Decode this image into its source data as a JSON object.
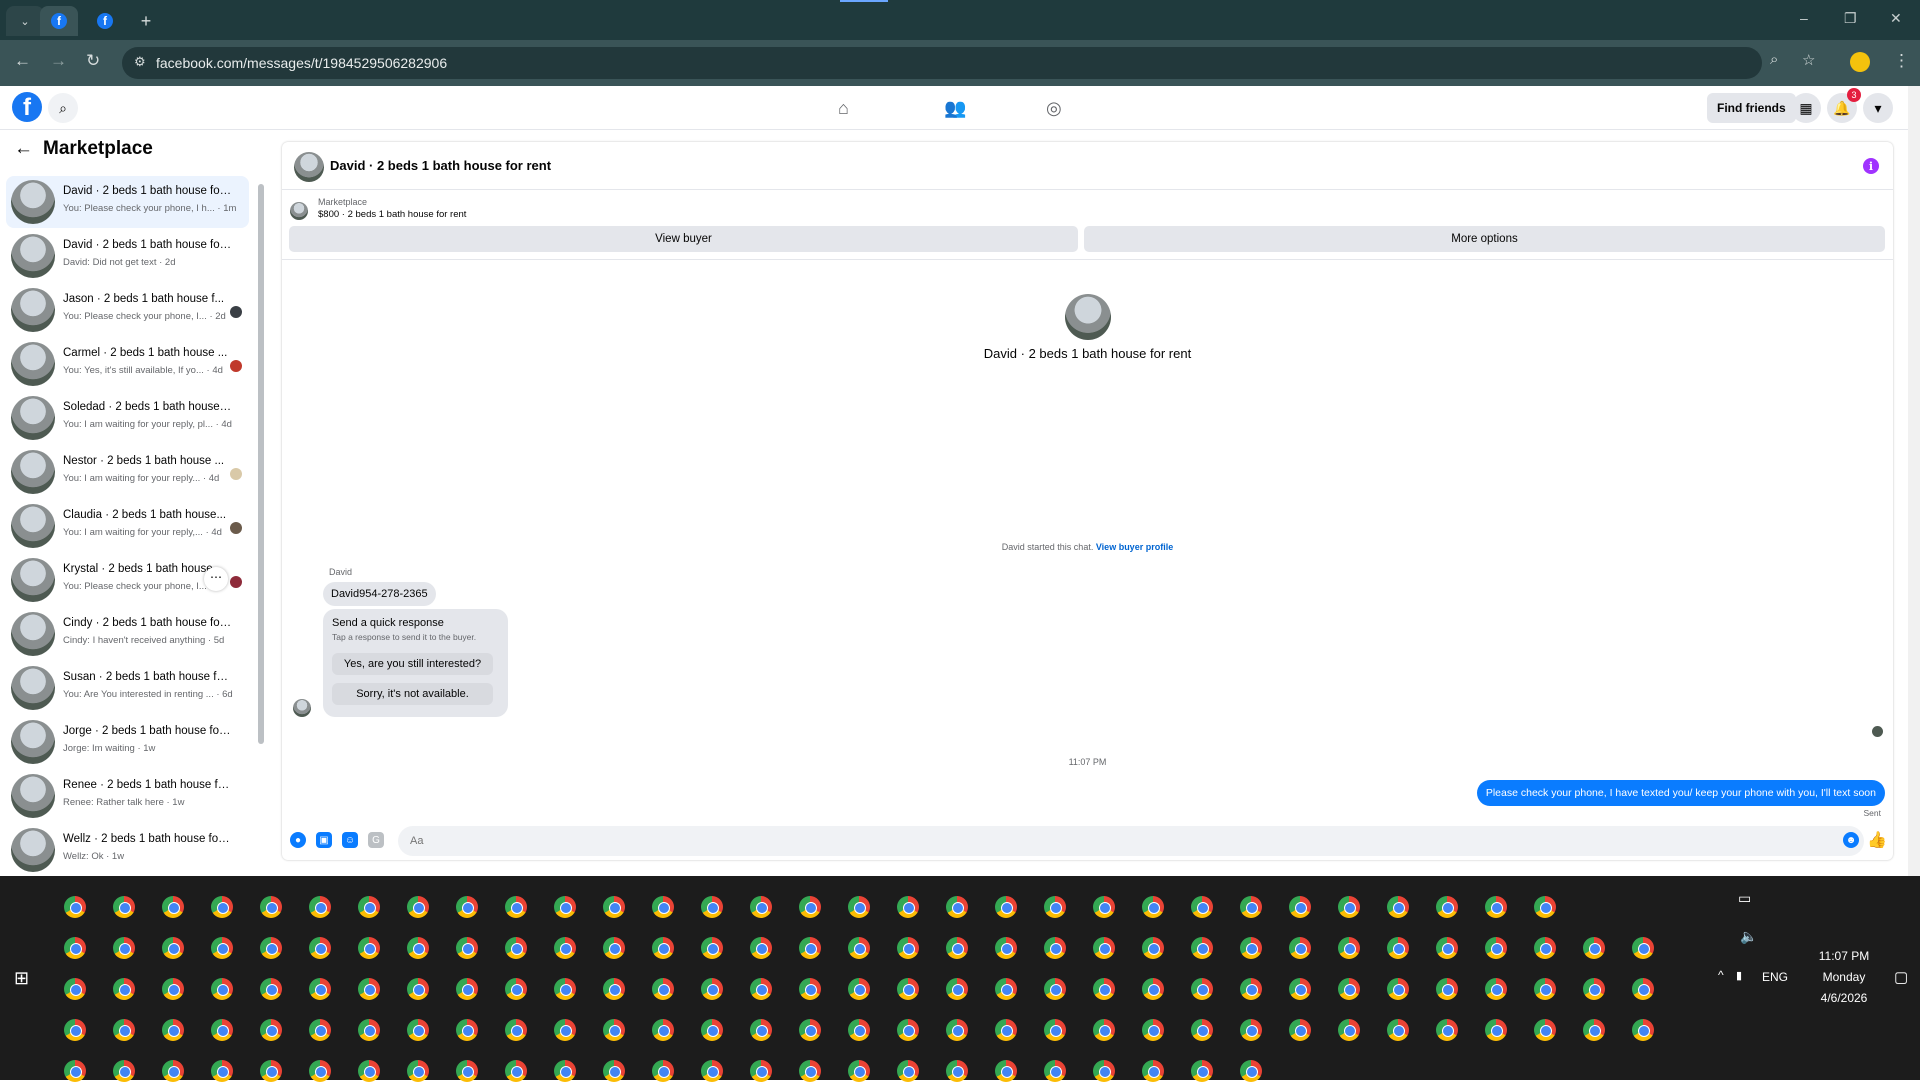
{
  "browser": {
    "url": "facebook.com/messages/t/1984529506282906",
    "new_tab": "+",
    "window_controls": [
      "–",
      "❐",
      "✕"
    ]
  },
  "fb_header": {
    "find_friends": "Find friends",
    "notification_count": "3"
  },
  "sidebar": {
    "title": "Marketplace",
    "conversations": [
      {
        "name": "David · 2 beds 1 bath house for ...",
        "preview": "You: Please check your phone, I h... · 1m"
      },
      {
        "name": "David · 2 beds 1 bath house for ...",
        "preview": "David: Did not get text · 2d"
      },
      {
        "name": "Jason · 2 beds 1 bath house f...",
        "preview": "You: Please check your phone, I... · 2d"
      },
      {
        "name": "Carmel · 2 beds 1 bath house ...",
        "preview": "You: Yes, it's still available, If yo... · 4d"
      },
      {
        "name": "Soledad · 2 beds 1 bath house f...",
        "preview": "You: I am waiting for your reply, pl... · 4d"
      },
      {
        "name": "Nestor · 2 beds 1 bath house ...",
        "preview": "You: I am waiting for your reply... · 4d"
      },
      {
        "name": "Claudia · 2 beds 1 bath house...",
        "preview": "You: I am waiting for your reply,... · 4d"
      },
      {
        "name": "Krystal · 2 beds 1 bath house",
        "preview": "You: Please check your phone, I..."
      },
      {
        "name": "Cindy · 2 beds 1 bath house for ...",
        "preview": "Cindy: I haven't received anything · 5d"
      },
      {
        "name": "Susan · 2 beds 1 bath house for ...",
        "preview": "You: Are You interested in renting ... · 6d"
      },
      {
        "name": "Jorge · 2 beds 1 bath house for ...",
        "preview": "Jorge: Im waiting · 1w"
      },
      {
        "name": "Renee · 2 beds 1 bath house for...",
        "preview": "Renee: Rather talk here · 1w"
      },
      {
        "name": "Wellz · 2 beds 1 bath house for ...",
        "preview": "Wellz: Ok · 1w"
      }
    ]
  },
  "chat": {
    "title": "David · 2 beds 1 bath house for rent",
    "info_icon": "i",
    "marketplace_label": "Marketplace",
    "listing": "$800 · 2 beds 1 bath house for rent",
    "view_buyer": "View buyer",
    "more_options": "More options",
    "profile_name": "David · 2 beds 1 bath house for rent",
    "started_note": "David started this chat.",
    "view_buyer_profile": "View buyer profile",
    "sender": "David",
    "incoming_message": "David954-278-2365",
    "quick_title": "Send a quick response",
    "quick_subtitle": "Tap a response to send it to the buyer.",
    "quick_1": "Yes, are you still interested?",
    "quick_2": "Sorry, it's not available.",
    "timestamp": "11:07 PM",
    "outgoing_message": "Please check your phone, I have texted you/ keep your phone with you, I'll text soon",
    "status": "Sent",
    "input_placeholder": "Aa"
  },
  "taskbar": {
    "lang": "ENG",
    "time": "11:07 PM",
    "day": "Monday",
    "date": "4/6/2026"
  }
}
